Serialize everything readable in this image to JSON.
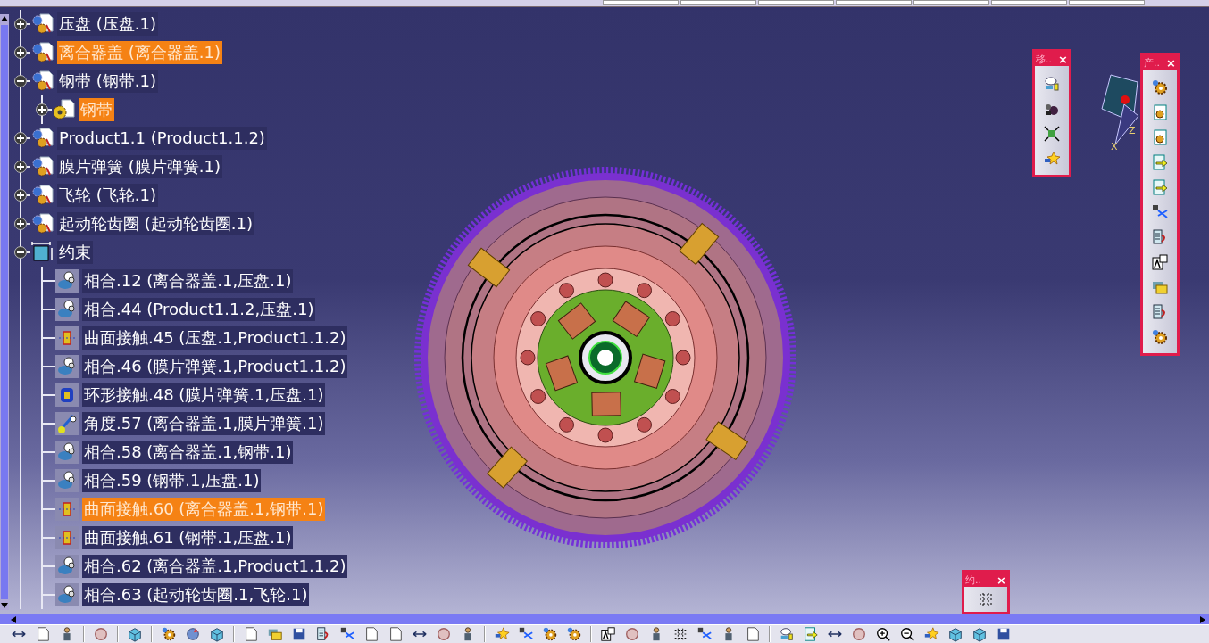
{
  "tree": [
    {
      "label": "压盘 (压盘.1)",
      "kind": "product",
      "expanded": false,
      "selected": false
    },
    {
      "label": "离合器盖 (离合器盖.1)",
      "kind": "product",
      "expanded": false,
      "selected": true
    },
    {
      "label": "钢带 (钢带.1)",
      "kind": "product",
      "expanded": true,
      "selected": false,
      "children": [
        {
          "label": "钢带",
          "kind": "part",
          "expanded": false,
          "selected": true
        }
      ]
    },
    {
      "label": "Product1.1 (Product1.1.2)",
      "kind": "product",
      "expanded": false,
      "selected": false
    },
    {
      "label": "膜片弹簧 (膜片弹簧.1)",
      "kind": "product",
      "expanded": false,
      "selected": false
    },
    {
      "label": "飞轮 (飞轮.1)",
      "kind": "product",
      "expanded": false,
      "selected": false
    },
    {
      "label": "起动轮齿圈 (起动轮齿圈.1)",
      "kind": "product",
      "expanded": false,
      "selected": false
    },
    {
      "label": "约束",
      "kind": "constraints",
      "expanded": true,
      "selected": false,
      "children": [
        {
          "label": "相合.12 (离合器盖.1,压盘.1)",
          "kind": "coincidence",
          "selected": false
        },
        {
          "label": "相合.44 (Product1.1.2,压盘.1)",
          "kind": "coincidence",
          "selected": false
        },
        {
          "label": "曲面接触.45 (压盘.1,Product1.1.2)",
          "kind": "contact",
          "selected": false
        },
        {
          "label": "相合.46 (膜片弹簧.1,Product1.1.2)",
          "kind": "coincidence",
          "selected": false
        },
        {
          "label": "环形接触.48 (膜片弹簧.1,压盘.1)",
          "kind": "ring-contact",
          "selected": false
        },
        {
          "label": "角度.57 (离合器盖.1,膜片弹簧.1)",
          "kind": "angle",
          "selected": false
        },
        {
          "label": "相合.58 (离合器盖.1,钢带.1)",
          "kind": "coincidence",
          "selected": false
        },
        {
          "label": "相合.59 (钢带.1,压盘.1)",
          "kind": "coincidence",
          "selected": false
        },
        {
          "label": "曲面接触.60 (离合器盖.1,钢带.1)",
          "kind": "contact",
          "selected": true
        },
        {
          "label": "曲面接触.61 (钢带.1,压盘.1)",
          "kind": "contact",
          "selected": false
        },
        {
          "label": "相合.62 (离合器盖.1,Product1.1.2)",
          "kind": "coincidence",
          "selected": false
        },
        {
          "label": "相合.63 (起动轮齿圈.1,飞轮.1)",
          "kind": "coincidence",
          "selected": false
        }
      ]
    }
  ],
  "toolbars": [
    {
      "title": "移..",
      "close": "×",
      "kind": "move"
    },
    {
      "title": "产..",
      "close": "×",
      "kind": "product"
    },
    {
      "title": "约..",
      "close": "×",
      "kind": "constraint"
    }
  ],
  "compass": {
    "x_label": "X",
    "z_label": "Z"
  }
}
